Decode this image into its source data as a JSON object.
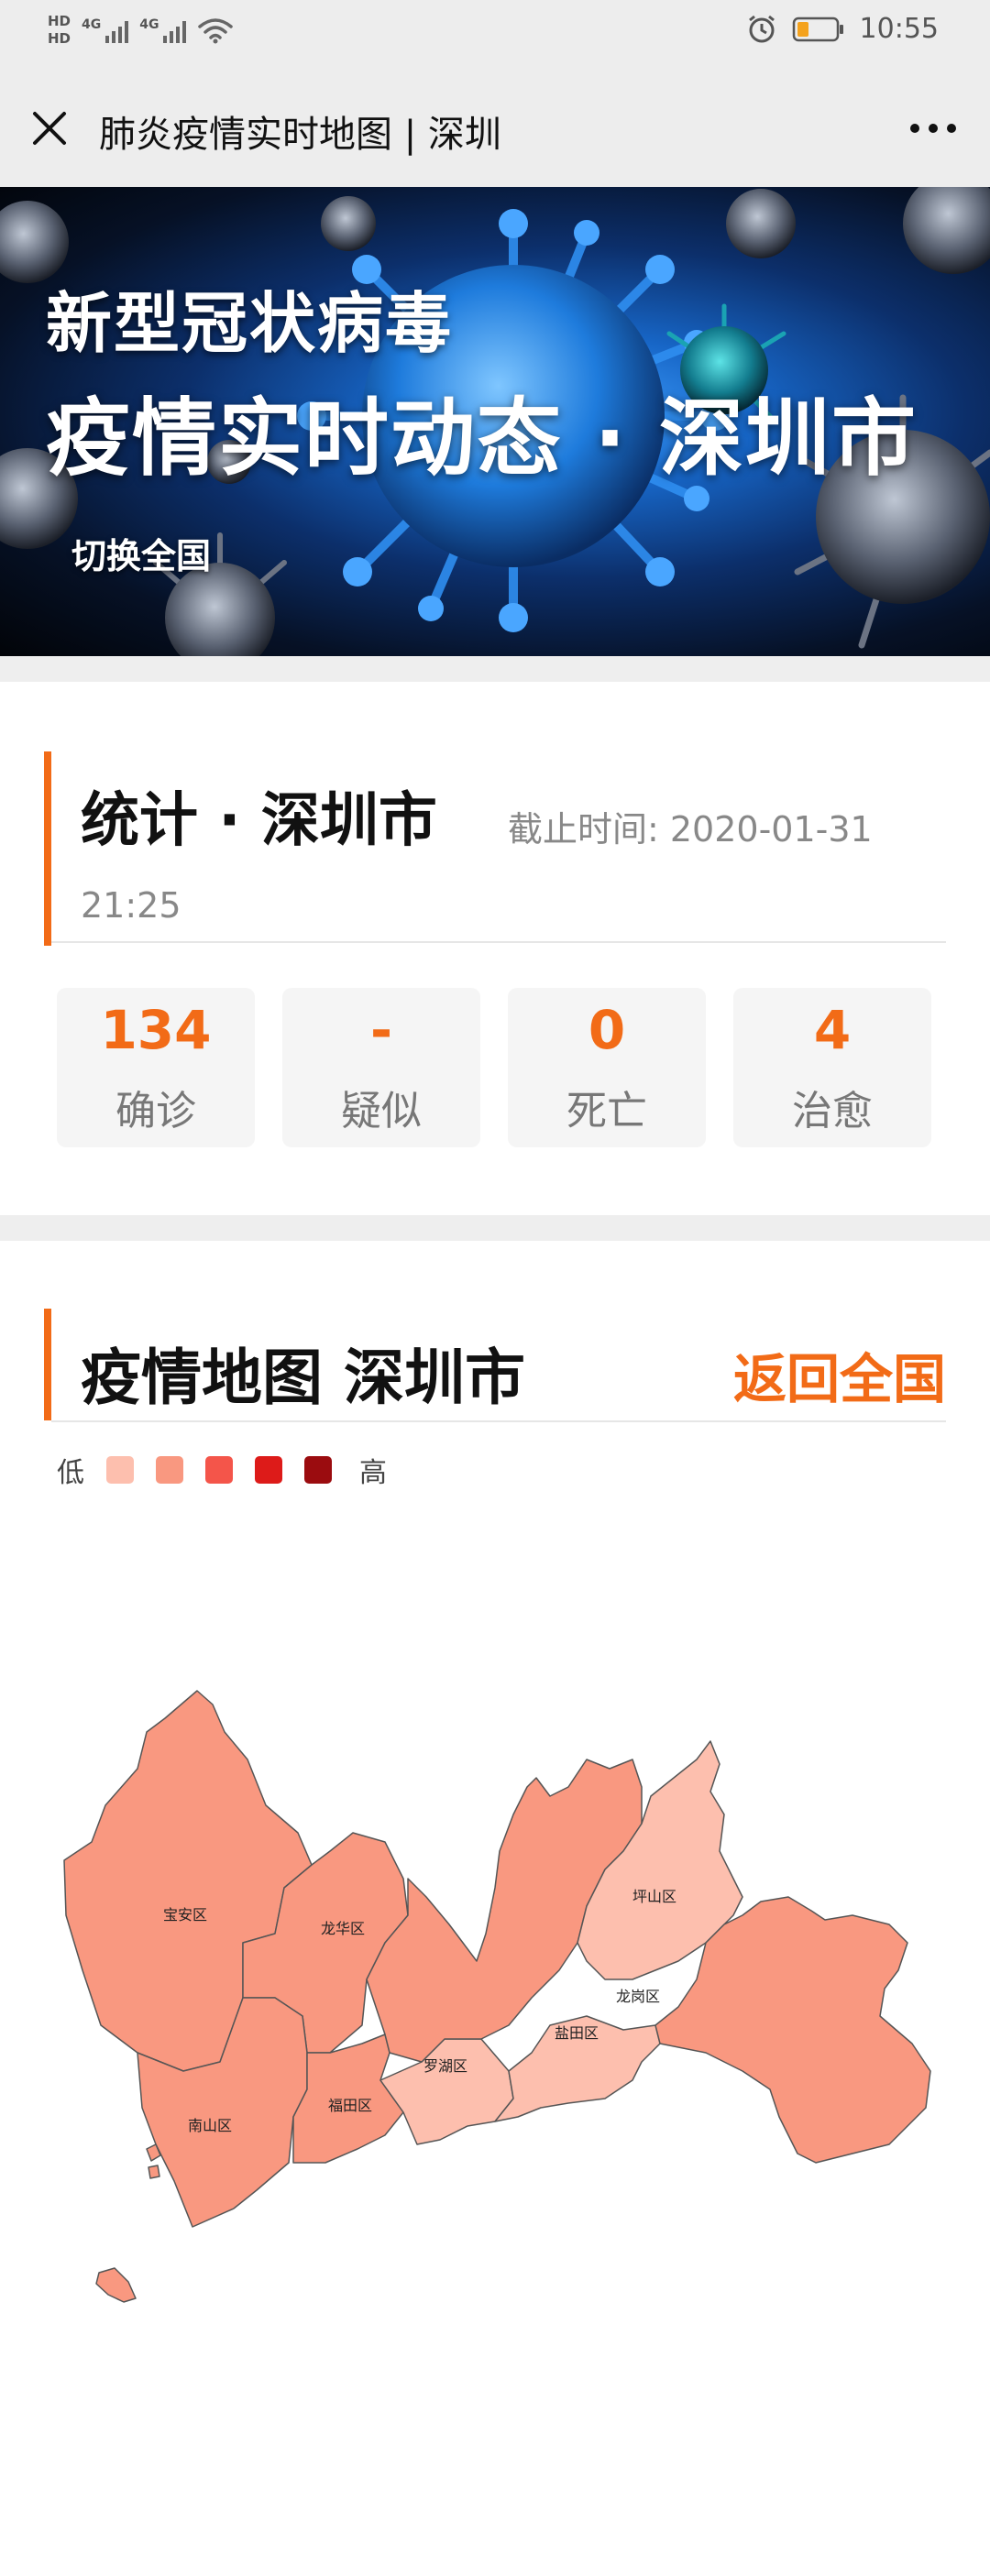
{
  "status_bar": {
    "hd_top": "HD",
    "hd_bottom": "HD",
    "network_1": "4G",
    "network_2": "4G",
    "time": "10:55",
    "battery_color": "#f4a21d"
  },
  "title_bar": {
    "title": "肺炎疫情实时地图 | 深圳"
  },
  "banner": {
    "line1": "新型冠状病毒",
    "line2": "疫情实时动态 · 深圳市",
    "switch_label": "切换全国"
  },
  "stats": {
    "title": "统计 · 深圳市",
    "time_label": "截止时间: 2020-01-31",
    "time_value": "21:25",
    "cards": [
      {
        "value": "134",
        "label": "确诊"
      },
      {
        "value": "-",
        "label": "疑似"
      },
      {
        "value": "0",
        "label": "死亡"
      },
      {
        "value": "4",
        "label": "治愈"
      }
    ]
  },
  "map": {
    "title": "疫情地图 深圳市",
    "back_label": "返回全国",
    "legend_low": "低",
    "legend_high": "高",
    "legend_colors": [
      "#fdbfae",
      "#f99880",
      "#f4554a",
      "#dd1b19",
      "#9b0c0f"
    ],
    "districts": [
      "宝安区",
      "龙华区",
      "坪山区",
      "龙岗区",
      "盐田区",
      "罗湖区",
      "福田区",
      "南山区"
    ]
  },
  "colors": {
    "accent": "#f26b17",
    "district_mid": "#f99880",
    "district_light": "#fdbfae"
  }
}
